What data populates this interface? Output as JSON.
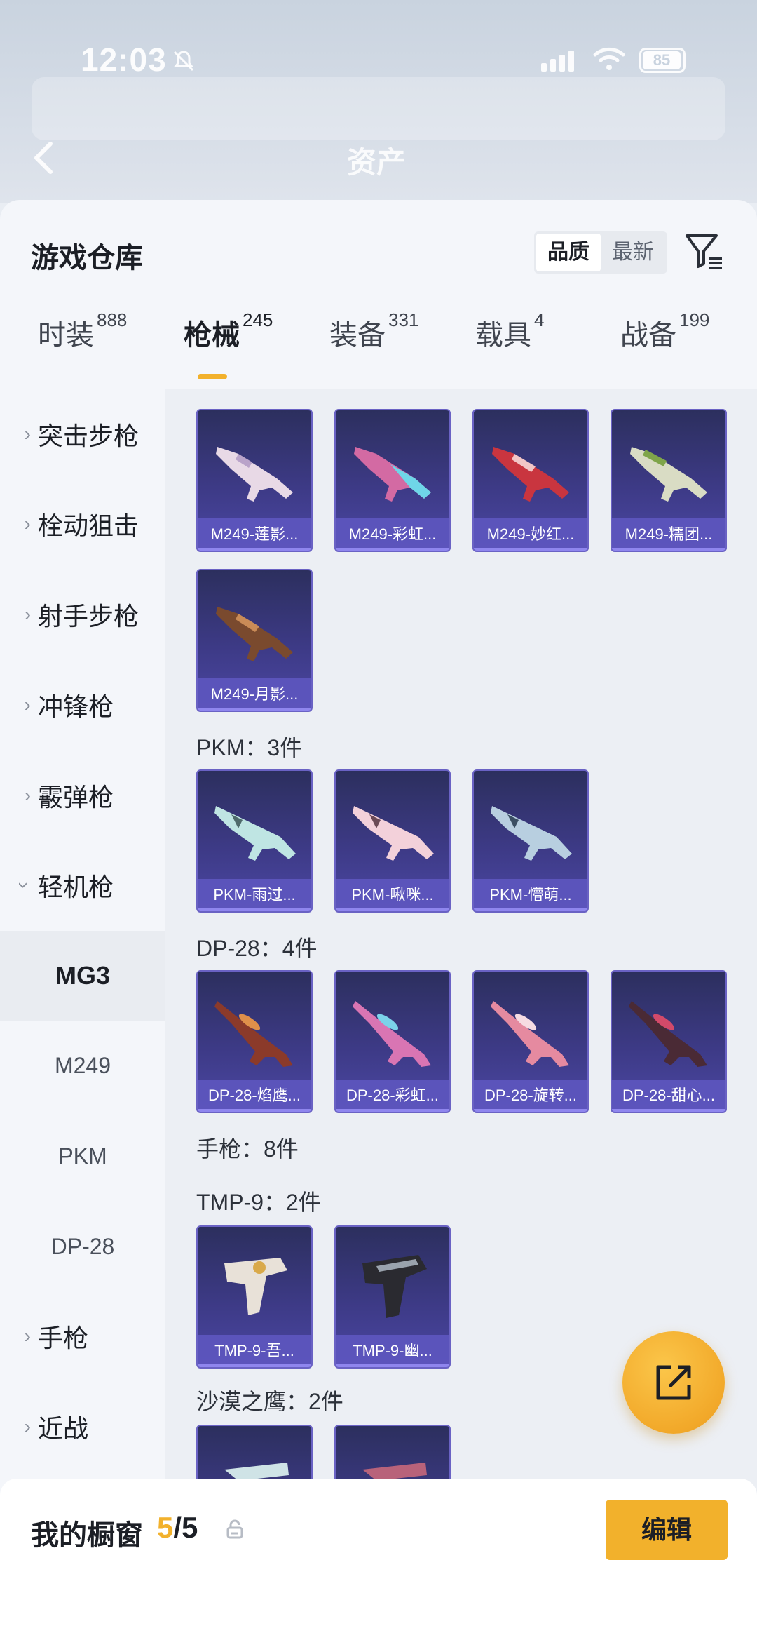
{
  "status_bar": {
    "time": "12:03",
    "battery": "85"
  },
  "header": {
    "title": "资产"
  },
  "panel": {
    "title": "游戏仓库",
    "sort_options": [
      "品质",
      "最新"
    ],
    "sort_selected": "品质"
  },
  "tabs": [
    {
      "label": "时装",
      "count": "888"
    },
    {
      "label": "枪械",
      "count": "245"
    },
    {
      "label": "装备",
      "count": "331"
    },
    {
      "label": "载具",
      "count": "4"
    },
    {
      "label": "战备",
      "count": "199"
    }
  ],
  "active_tab": "枪械",
  "sidebar": {
    "categories": [
      {
        "label": "突击步枪",
        "expanded": false
      },
      {
        "label": "栓动狙击",
        "expanded": false
      },
      {
        "label": "射手步枪",
        "expanded": false
      },
      {
        "label": "冲锋枪",
        "expanded": false
      },
      {
        "label": "霰弹枪",
        "expanded": false
      },
      {
        "label": "轻机枪",
        "expanded": true
      }
    ],
    "subcategories": [
      {
        "label": "MG3",
        "active": true
      },
      {
        "label": "M249",
        "active": false
      },
      {
        "label": "PKM",
        "active": false
      },
      {
        "label": "DP-28",
        "active": false
      }
    ],
    "more_categories": [
      {
        "label": "手枪",
        "expanded": false
      },
      {
        "label": "近战",
        "expanded": false
      }
    ]
  },
  "content": {
    "m249_items": [
      "M249-莲影...",
      "M249-彩虹...",
      "M249-妙红...",
      "M249-糯团...",
      "M249-月影..."
    ],
    "pkm_label": "PKM：3件",
    "pkm_items": [
      "PKM-雨过...",
      "PKM-啾咪...",
      "PKM-懵萌..."
    ],
    "dp28_label": "DP-28：4件",
    "dp28_items": [
      "DP-28-焰鹰...",
      "DP-28-彩虹...",
      "DP-28-旋转...",
      "DP-28-甜心..."
    ],
    "pistol_label": "手枪：8件",
    "tmp9_label": "TMP-9：2件",
    "tmp9_items": [
      "TMP-9-吾...",
      "TMP-9-幽..."
    ],
    "deagle_label": "沙漠之鹰：2件"
  },
  "bottom_bar": {
    "label": "我的橱窗",
    "current": "5",
    "separator": "/",
    "total": "5",
    "edit_label": "编辑"
  },
  "colors": {
    "accent": "#f2b12c",
    "card_bg": "#3d3a86",
    "card_caption": "#5d56be"
  },
  "icons": [
    "back-arrow-icon",
    "filter-icon",
    "lock-icon",
    "share-icon",
    "bell-mute-icon",
    "wifi-icon",
    "signal-icon",
    "battery-icon"
  ]
}
